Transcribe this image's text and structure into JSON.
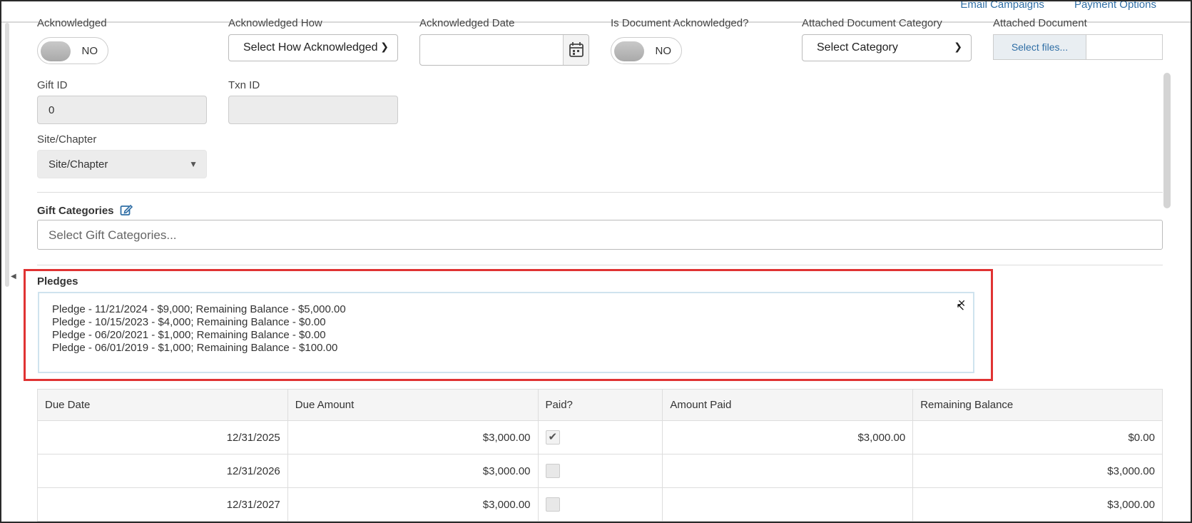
{
  "top_links": [
    "Email Campaigns",
    "Payment Options"
  ],
  "fields": {
    "acknowledged": {
      "label": "Acknowledged",
      "value": "NO"
    },
    "acknowledged_how": {
      "label": "Acknowledged How",
      "value": "Select How Acknowledged"
    },
    "acknowledged_date": {
      "label": "Acknowledged Date",
      "value": ""
    },
    "is_doc_ack": {
      "label": "Is Document Acknowledged?",
      "value": "NO"
    },
    "doc_category": {
      "label": "Attached Document Category",
      "value": "Select Category"
    },
    "attached_doc": {
      "label": "Attached Document",
      "button": "Select files..."
    },
    "gift_id": {
      "label": "Gift ID",
      "value": "0"
    },
    "txn_id": {
      "label": "Txn ID",
      "value": ""
    },
    "site_chapter": {
      "label": "Site/Chapter",
      "value": "Site/Chapter"
    },
    "gift_categories": {
      "label": "Gift Categories",
      "placeholder": "Select Gift Categories..."
    }
  },
  "pledges": {
    "label": "Pledges",
    "items": [
      "Pledge - 11/21/2024 - $9,000; Remaining Balance - $5,000.00",
      "Pledge - 10/15/2023 - $4,000; Remaining Balance - $0.00",
      "Pledge - 06/20/2021 - $1,000; Remaining Balance - $0.00",
      "Pledge - 06/01/2019 - $1,000; Remaining Balance - $100.00"
    ]
  },
  "table": {
    "headers": [
      "Due Date",
      "Due Amount",
      "Paid?",
      "Amount Paid",
      "Remaining Balance"
    ],
    "rows": [
      {
        "due_date": "12/31/2025",
        "due_amount": "$3,000.00",
        "paid": true,
        "amount_paid": "$3,000.00",
        "remaining": "$0.00"
      },
      {
        "due_date": "12/31/2026",
        "due_amount": "$3,000.00",
        "paid": false,
        "amount_paid": "",
        "remaining": "$3,000.00"
      },
      {
        "due_date": "12/31/2027",
        "due_amount": "$3,000.00",
        "paid": false,
        "amount_paid": "",
        "remaining": "$3,000.00"
      }
    ]
  },
  "colors": {
    "link": "#2f6ea5",
    "highlight": "#e03333"
  }
}
